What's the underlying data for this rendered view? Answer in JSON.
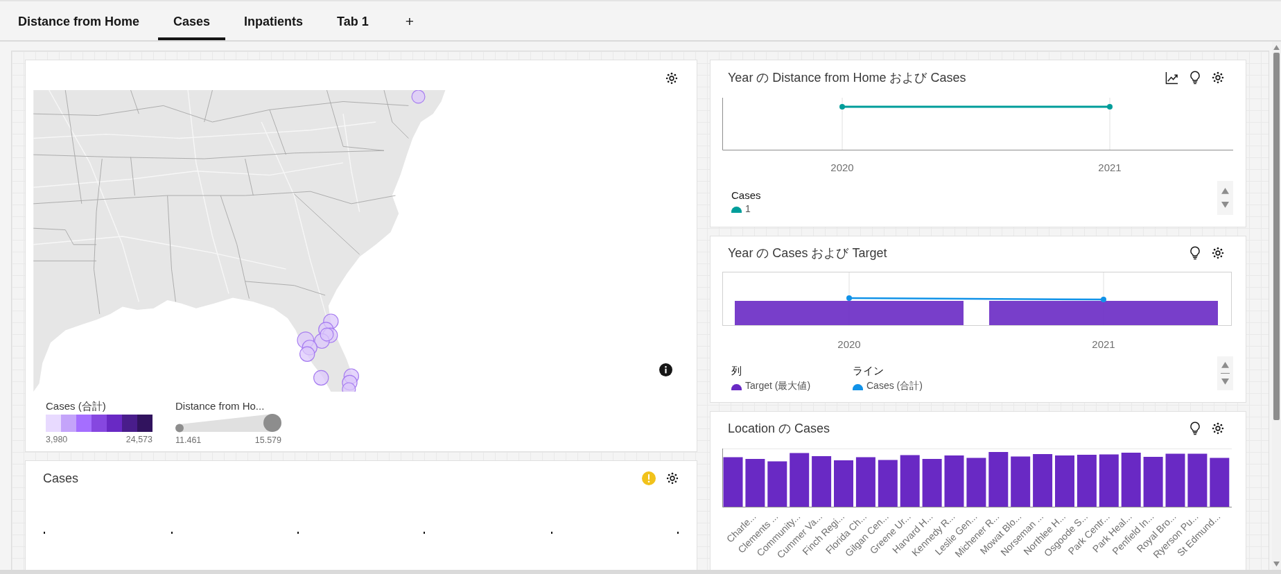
{
  "tabs": [
    {
      "label": "Distance from Home",
      "selected": false
    },
    {
      "label": "Cases",
      "selected": true
    },
    {
      "label": "Inpatients",
      "selected": false
    },
    {
      "label": "Tab 1",
      "selected": false
    }
  ],
  "add_tab": {
    "label": "+"
  },
  "map_panel": {
    "color_legend": {
      "title": "Cases (合計)",
      "swatches": [
        {
          "color": "#e8daff"
        },
        {
          "color": "#c4a4fa"
        },
        {
          "color": "#a56eff"
        },
        {
          "color": "#8647e0"
        },
        {
          "color": "#6929c4"
        },
        {
          "color": "#491d8b"
        },
        {
          "color": "#31135e"
        }
      ],
      "min_label": "3,980",
      "max_label": "24,573"
    },
    "size_legend": {
      "title": "Distance from Ho...",
      "min_label": "11.461",
      "max_label": "15.579"
    }
  },
  "cases_panel": {
    "title": "Cases",
    "warning": true
  },
  "distance_cases_panel": {
    "title": "Year の Distance from Home および Cases",
    "x_labels": [
      "2020",
      "2021"
    ],
    "legend": {
      "title": "Cases",
      "items": [
        {
          "label": "1",
          "color": "#009d9a"
        }
      ]
    }
  },
  "cases_target_panel": {
    "title": "Year の Cases および Target",
    "x_labels": [
      "2020",
      "2021"
    ],
    "legend_groups": [
      {
        "title": "列",
        "items": [
          {
            "label": "Target (最大値)",
            "color": "#6929c4"
          }
        ]
      },
      {
        "title": "ライン",
        "items": [
          {
            "label": "Cases (合計)",
            "color": "#1192e8"
          }
        ]
      }
    ]
  },
  "location_cases_panel": {
    "title": "Location の Cases",
    "x_labels": [
      "Charle...",
      "Clements ...",
      "Community...",
      "Cummer Va...",
      "Finch Regi...",
      "Florida Ch...",
      "Gilgan Cen...",
      "Greene Ur...",
      "Harvard H...",
      "Kennedy R...",
      "Leslie Gen...",
      "Michener R...",
      "Mowat Blo...",
      "Norseman ...",
      "Northlee H...",
      "Osgoode S...",
      "Park Centr...",
      "Park Heal...",
      "Penfield In...",
      "Royal Bro...",
      "Ryerson Pu...",
      "St Edmund..."
    ]
  }
}
